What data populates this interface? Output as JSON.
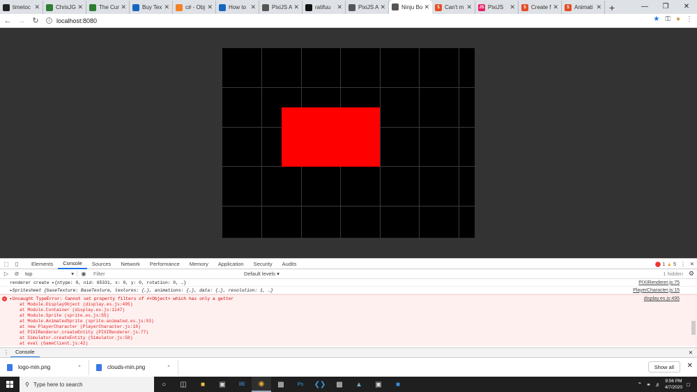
{
  "browser": {
    "tabs": [
      {
        "title": "timetoc",
        "color": "#222222",
        "glyph": "",
        "active": false
      },
      {
        "title": "ChrisJGr",
        "color": "#2e7d32",
        "glyph": "",
        "active": false
      },
      {
        "title": "The Cur",
        "color": "#2e7d32",
        "glyph": "",
        "active": false
      },
      {
        "title": "Buy Text",
        "color": "#1565c0",
        "glyph": "",
        "active": false
      },
      {
        "title": "c# - Obj",
        "color": "#f48024",
        "glyph": "",
        "active": false
      },
      {
        "title": "How to",
        "color": "#1565c0",
        "glyph": "",
        "active": false
      },
      {
        "title": "PixiJS API",
        "color": "#555555",
        "glyph": "",
        "active": false
      },
      {
        "title": "ratifuu",
        "color": "#111111",
        "glyph": "",
        "active": false
      },
      {
        "title": "PixiJS API",
        "color": "#555555",
        "glyph": "",
        "active": false
      },
      {
        "title": "Ninju Bo",
        "color": "#555555",
        "glyph": "",
        "active": true
      },
      {
        "title": "Can't m",
        "color": "#e44d26",
        "glyph": "5",
        "active": false
      },
      {
        "title": "PixiJS",
        "color": "#e91e63",
        "glyph": "JS",
        "active": false
      },
      {
        "title": "Create fr",
        "color": "#e44d26",
        "glyph": "5",
        "active": false
      },
      {
        "title": "Animati",
        "color": "#e44d26",
        "glyph": "5",
        "active": false
      }
    ],
    "url": "localhost:8080"
  },
  "devtools": {
    "tabs": [
      "Elements",
      "Console",
      "Sources",
      "Network",
      "Performance",
      "Memory",
      "Application",
      "Security",
      "Audits"
    ],
    "active_tab": "Console",
    "error_count": "1",
    "warning_count": "5",
    "context": "top",
    "filter_placeholder": "Filter",
    "levels": "Default levels ▾",
    "hidden": "1 hidden",
    "log_lines": [
      {
        "text": "renderer create ▸{ntype: 0, nid: 65331, x: 0, y: 0, rotation: 0, …}",
        "source": "PIXIRenderer.js:75"
      },
      {
        "text": "▸Spritesheet {baseTexture: BaseTexture, textures: {…}, animations: {…}, data: {…}, resolution: 1, …}",
        "source": "PlayerCharacter.js:15"
      }
    ],
    "error": {
      "message": "▸Uncaught TypeError: Cannot set property filters of #<Object> which has only a getter",
      "source": "display.es.js:495",
      "stack": [
        "at Module.DisplayObject (display.es.js:495)",
        "at Module.Container (display.es.js:1147)",
        "at Module.Sprite (sprite.es.js:55)",
        "at Module.AnimatedSprite (sprite-animated.es.js:53)",
        "at new PlayerCharacter (PlayerCharacter.js:18)",
        "at PIXIRenderer.createEntity (PIXIRenderer.js:77)",
        "at Simulator.createEntity (Simulator.js:58)",
        "at eval (GameClient.js:42)"
      ]
    },
    "drawer_tab": "Console"
  },
  "downloads": {
    "items": [
      "logo-min.png",
      "clouds-min.png"
    ],
    "show_all": "Show all"
  },
  "taskbar": {
    "search_placeholder": "Type here to search",
    "time": "9:56 PM",
    "date": "4/7/2020"
  }
}
